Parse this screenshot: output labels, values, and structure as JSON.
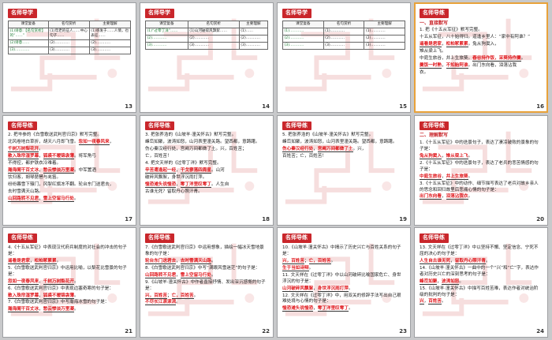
{
  "colors": {
    "accent": "#c9262b",
    "answer": "#e0161b",
    "answer_blue": "#1d4fb0",
    "selection": "#e8a23a"
  },
  "slides": [
    {
      "num": "13",
      "tag": "名师导学",
      "type": "table",
      "headers": [
        "课堂复备",
        "名句赏析",
        "主要理解"
      ],
      "rows": [
        [
          "(1)诗意:【名句赏析】的“……”",
          "(1)年老的征人……中心句子……",
          "(1)感发于……人情，也表征……"
        ],
        [
          "(2)诗意……",
          "(2)…………",
          "(2)…………"
        ],
        [
          "(3)…………",
          "(3)…………",
          "(3)…………"
        ]
      ]
    },
    {
      "num": "14",
      "tag": "名师导学",
      "type": "table",
      "headers": [
        "课堂复备",
        "名句赏析",
        "主要理解"
      ],
      "rows": [
        [
          "(1)“过零丁洋”……",
          "(1)山河破碎风飘絮……",
          "(1)……"
        ],
        [
          "(2)…………",
          "(2)…………",
          "(2)…………"
        ],
        [
          "(3)…………",
          "(3)…………",
          "(3)…………"
        ]
      ]
    },
    {
      "num": "15",
      "tag": "名师导学",
      "type": "table",
      "headers": [
        "课堂复备",
        "名句赏析",
        "主要理解"
      ],
      "rows": [
        [
          "(1)…………",
          "(1)…………",
          "(1)…………"
        ],
        [
          "(2)…………",
          "(2)…………",
          "(2)…………"
        ],
        [
          "(3)…………",
          "(3)…………",
          "(3)…………"
        ]
      ]
    },
    {
      "num": "16",
      "tag": "名师导练",
      "type": "text",
      "section": "一、直接默写",
      "lines": [
        {
          "t": "1. 把《十五从军征》默写完整。"
        },
        {
          "t": "十五从军征，八十始得归。道逢乡里人：“家中有阿谁？”"
        },
        {
          "a": "遥看是君家",
          "t2": "，",
          "a2": "松柏冢累累",
          "t3": "。兔从狗窦入，"
        },
        {
          "t": "雉从梁上飞。"
        },
        {
          "t": "中庭生旅谷，井上生旅葵。",
          "a": "舂谷持作饭，采葵持作羹",
          "t2": "。"
        },
        {
          "a": "羹饭一时熟",
          "t2": "，",
          "a2": "不知贻阿谁",
          "t3": "。出门东向看，泪落沾我"
        },
        {
          "t": "衣。"
        }
      ]
    },
    {
      "num": "17",
      "tag": "名师导练",
      "type": "text",
      "lines": [
        {
          "t": "2. 把岑参的《白雪歌送武判官归京》默写完整。"
        },
        {
          "t": "北风卷地白草折，胡天八月即飞雪。",
          "a": "忽如一夜春风来",
          "t2": "，"
        },
        {
          "a": "千树万树梨花开",
          "t2": "。"
        },
        {
          "a": "散入珠帘湿罗幕",
          "t2": "，",
          "a2": "狐裘不暖锦衾薄",
          "t3": "。将军角弓"
        },
        {
          "t": "不得控，都护铁衣冷难着。"
        },
        {
          "a": "瀚海阑干百丈冰",
          "t2": "，",
          "a2": "愁云惨淡万里凝",
          "t3": "。中军置酒"
        },
        {
          "t": "饮归客，胡琴琵琶与羌笛。"
        },
        {
          "t": "纷纷暮雪下辕门，风掣红旗冻不翻。轮台东门送君去，"
        },
        {
          "t": "去时雪满天山路。"
        },
        {
          "a": "山回路转不见君",
          "t2": "，",
          "a2": "雪上空留马行处",
          "t3": "。"
        }
      ]
    },
    {
      "num": "18",
      "tag": "名师导练",
      "type": "text",
      "lines": [
        {
          "t": "3. 把张养浩的《山坡羊·潼关怀古》默写完整。"
        },
        {
          "t": "峰峦如聚，波涛如怒，山河表里潼关路。望西都，意踌躇。"
        },
        {
          "t": "伤心秦汉经行处，宫阙万间都做了土。兴，百姓苦；"
        },
        {
          "t": "亡，百姓苦！"
        },
        {
          "t": "4. 把文天祥的《过零丁洋》默写完整。"
        },
        {
          "a": "辛苦遭逢起一经",
          "t2": "，",
          "a2": "干戈寥落四周星",
          "t3": "。山河"
        },
        {
          "t": "破碎风飘絮，身世浮沉雨打萍。"
        },
        {
          "a": "惶恐滩头说惶恐",
          "t2": "，",
          "a2": "零丁洋里叹零丁",
          "t3": "。人生自"
        },
        {
          "t": "古谁无死？留取丹心照汗青。"
        }
      ]
    },
    {
      "num": "19",
      "tag": "名师导练",
      "type": "text",
      "lines": [
        {
          "t": "5. 把张养浩的《山坡羊·潼关怀古》默写完整。"
        },
        {
          "t": "峰峦如聚，波涛如怒，山河表里潼关路。望西都，意踌躇。"
        },
        {
          "a": "伤心秦汉经行处",
          "t2": "，",
          "a2": "宫阙万间都做了土",
          "t3": "。兴，"
        },
        {
          "t": "百姓苦；亡，百姓苦！"
        }
      ]
    },
    {
      "num": "20",
      "tag": "名师导练",
      "type": "text",
      "section": "二、理解默写",
      "lines": [
        {
          "t": "1.《十五从军征》中的迭景句子，表达了凄凉破败的景象的句子是："
        },
        {
          "a": "兔从狗窦入",
          "t2": "，",
          "a2": "雉从梁上飞",
          "t3": "。"
        },
        {
          "t": "2.《十五从军征》中的迭景句子，表达了老兵的悲苦情感的句子是："
        },
        {
          "a": "中庭生旅谷",
          "t2": "，",
          "a2": "井上生旅葵",
          "t3": "。"
        },
        {
          "t": "3.《十五从军征》中的动作、细节描写表达了老兵对故乡亲人的思念和回归故里后悲痛心情的句子是："
        },
        {
          "a": "出门东向看",
          "t2": "，",
          "a2": "泪落沾我衣",
          "t3": "。"
        }
      ]
    },
    {
      "num": "21",
      "tag": "名师导练",
      "type": "text",
      "lines": [
        {
          "t": "4.《十五从军征》中表现汉代府兵制度的对社会的冲击的句子是："
        },
        {
          "a": "遥看是君家",
          "t2": "，",
          "a2": "松柏冢累累",
          "t3": "。"
        },
        {
          "t": "5.《白雪歌送武判官归京》中运用比喻，以梨花比雪景的句子是："
        },
        {
          "a": "忽如一夜春风来",
          "t2": "，",
          "a2": "千树万树梨花开",
          "t3": "。"
        },
        {
          "t": "6.《白雪歌送武判官归京》中表现边塞奇寒的句子是："
        },
        {
          "a": "散入珠帘湿罗幕",
          "t2": "，",
          "a2": "狐裘不暖锦衾薄",
          "t3": "。"
        },
        {
          "t": "7.《白雪歌送武判官归京》中写瀚海冰雪的句子是："
        },
        {
          "a": "瀚海阑干百丈冰",
          "t2": "，",
          "a2": "愁云惨淡万里凝",
          "t3": "。"
        }
      ]
    },
    {
      "num": "22",
      "tag": "名师导练",
      "type": "text",
      "lines": [
        {
          "t": "7.《白雪歌送武判官归京》中运用想象，描绘一幅冰天雪地景象的句子是："
        },
        {
          "a": "轮台东门送君去",
          "t2": "，",
          "a2": "去时雪满天山路",
          "t3": "。"
        },
        {
          "t": "8.《白雪歌送武判官归京》中写“满眼风雪迷茫”的句子是："
        },
        {
          "a": "山回路转不见君",
          "t2": "，",
          "a2": "雪上空留马行处",
          "t3": "。"
        },
        {
          "t": "9.《山坡羊·潼关怀古》中作者直接抒情、发出深沉感慨的句子是："
        },
        {
          "a": "兴，百姓苦",
          "t2": "；",
          "a2": "亡，百姓苦",
          "t3": "。"
        },
        {
          "a": "不尽长江滚滚流",
          "t2": "。"
        }
      ]
    },
    {
      "num": "23",
      "tag": "名师导练",
      "type": "text",
      "lines": [
        {
          "t": "10.《山坡羊·潼关怀古》中揭示了历史兴亡与百姓关系的句子是："
        },
        {
          "a": "兴，百姓苦",
          "t2": "；",
          "a2": "亡，百姓苦",
          "t3": "。"
        },
        {
          "a": "生于当如诗辩",
          "t2": "。"
        },
        {
          "t": "11. 文天祥在《过零丁洋》中以山河破碎比喻国家危亡、身世浮沉的句子是："
        },
        {
          "a": "山河破碎风飘絮",
          "t2": "，",
          "a2": "身世浮沉雨打萍",
          "t3": "。"
        },
        {
          "t": "12. 文天祥在《过零丁洋》中，用双关的修辞手法写出自己艰难处境与心情的句子是："
        },
        {
          "a": "惶恐滩头说惶恐",
          "t2": "，",
          "a2": "零丁洋里叹零丁",
          "t3": "。"
        }
      ]
    },
    {
      "num": "24",
      "tag": "名师导练",
      "type": "text",
      "lines": [
        {
          "t": "13. 文天祥在《过零丁洋》中以坚持不懈、坚定信念、宁死不屈的决心的句子是："
        },
        {
          "a": "人生自古谁无死",
          "t2": "，",
          "a2": "留取丹心照汗青",
          "t3": "。"
        },
        {
          "t": "14.《山坡羊·潼关怀古》一曲中的一个“兴”和“亡”字，表达作者对历史兴亡的深刻思考的句子是："
        },
        {
          "a": "峰峦如聚",
          "t2": "，",
          "a2": "波涛如怒",
          "t3": "。"
        },
        {
          "t": "15.《山坡羊·潼关怀古》中描写百姓苦难，表达作者对统治阶级的批判的句子是："
        },
        {
          "a": "兴",
          "t2": "，",
          "a2": "百姓苦",
          "t3": "。"
        }
      ]
    }
  ]
}
